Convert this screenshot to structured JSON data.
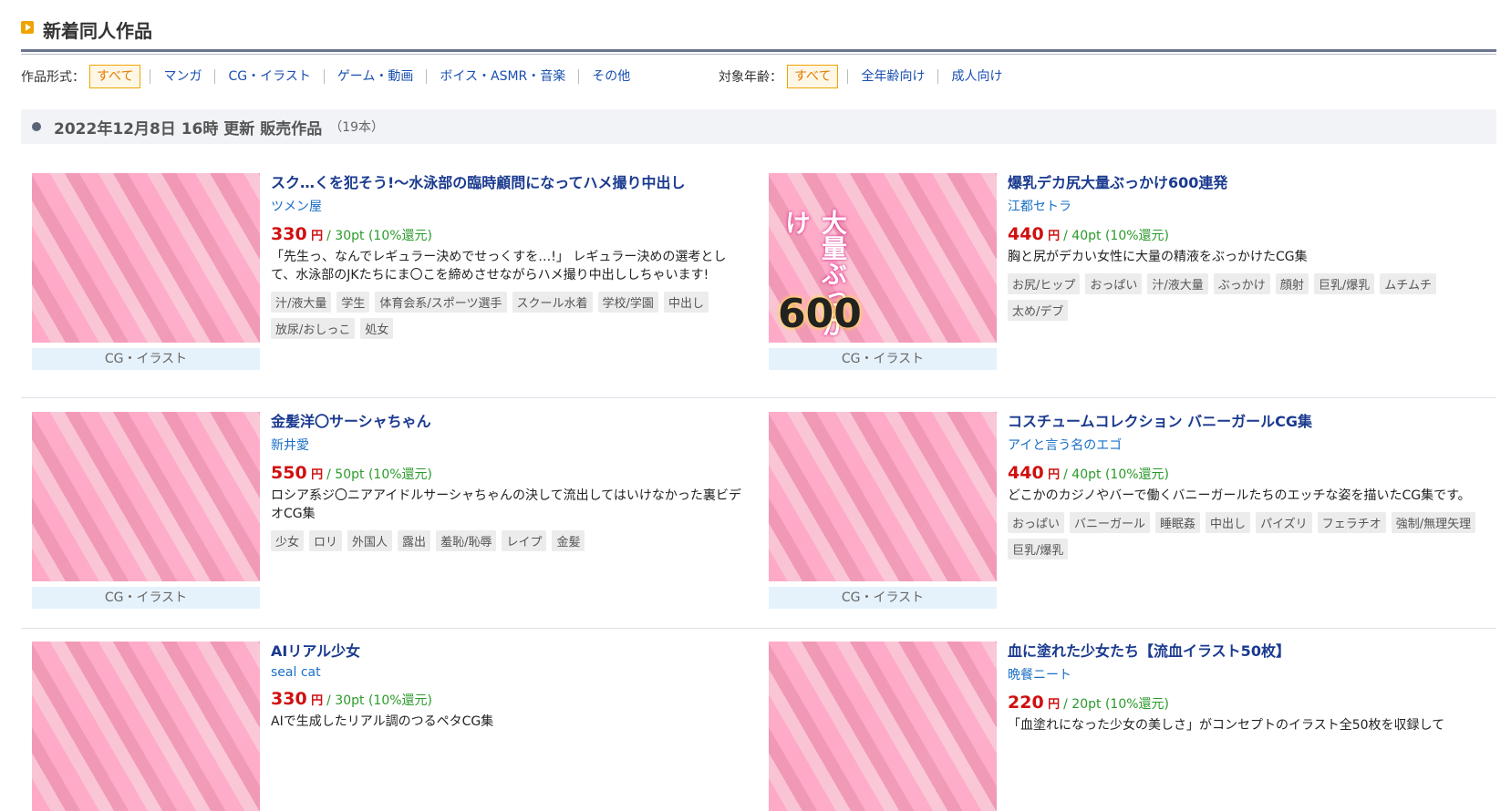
{
  "header": {
    "title": "新着同人作品"
  },
  "filters": {
    "format_label": "作品形式：",
    "format_items": [
      "すべて",
      "マンガ",
      "CG・イラスト",
      "ゲーム・動画",
      "ボイス・ASMR・音楽",
      "その他"
    ],
    "age_label": "対象年齢：",
    "age_items": [
      "すべて",
      "全年齢向け",
      "成人向け"
    ]
  },
  "section": {
    "title": "2022年12月8日 16時 更新 販売作品",
    "count": "（19本）"
  },
  "products": [
    {
      "title": "スク…くを犯そう!〜水泳部の臨時顧問になってハメ撮り中出し",
      "maker": "ツメン屋",
      "price": "330",
      "yen": "円",
      "points": "/ 30pt (10%還元)",
      "desc": "「先生っ、なんでレギュラー決めでせっくすを…!」 レギュラー決めの選考として、水泳部のJKたちにま〇こを締めさせながらハメ撮り中出ししちゃいます!",
      "category": "CG・イラスト",
      "tags": [
        "汁/液大量",
        "学生",
        "体育会系/スポーツ選手",
        "スクール水着",
        "学校/学園",
        "中出し",
        "放尿/おしっこ",
        "処女"
      ]
    },
    {
      "title": "爆乳デカ尻大量ぶっかけ600連発",
      "maker": "江都セトラ",
      "price": "440",
      "yen": "円",
      "points": "/ 40pt (10%還元)",
      "desc": "胸と尻がデカい女性に大量の精液をぶっかけたCG集",
      "category": "CG・イラスト",
      "thumb_text": "600",
      "thumb_vtext": "大量ぶっかけ",
      "tags": [
        "お尻/ヒップ",
        "おっぱい",
        "汁/液大量",
        "ぶっかけ",
        "顔射",
        "巨乳/爆乳",
        "ムチムチ",
        "太め/デブ"
      ]
    },
    {
      "title": "金髪洋〇サーシャちゃん",
      "maker": "新井愛",
      "price": "550",
      "yen": "円",
      "points": "/ 50pt (10%還元)",
      "desc": "ロシア系ジ〇ニアアイドルサーシャちゃんの決して流出してはいけなかった裏ビデオCG集",
      "category": "CG・イラスト",
      "tags": [
        "少女",
        "ロリ",
        "外国人",
        "露出",
        "羞恥/恥辱",
        "レイプ",
        "金髪"
      ]
    },
    {
      "title": "コスチュームコレクション バニーガールCG集",
      "maker": "アイと言う名のエゴ",
      "price": "440",
      "yen": "円",
      "points": "/ 40pt (10%還元)",
      "desc": "どこかのカジノやバーで働くバニーガールたちのエッチな姿を描いたCG集です。",
      "category": "CG・イラスト",
      "tags": [
        "おっぱい",
        "バニーガール",
        "睡眠姦",
        "中出し",
        "パイズリ",
        "フェラチオ",
        "強制/無理矢理",
        "巨乳/爆乳"
      ]
    },
    {
      "title": "AIリアル少女",
      "maker": "seal cat",
      "price": "330",
      "yen": "円",
      "points": "/ 30pt (10%還元)",
      "desc": "AIで生成したリアル調のつるペタCG集",
      "category": "",
      "tags": []
    },
    {
      "title": "血に塗れた少女たち【流血イラスト50枚】",
      "maker": "晩餐ニート",
      "price": "220",
      "yen": "円",
      "points": "/ 20pt (10%還元)",
      "desc": "「血塗れになった少女の美しさ」がコンセプトのイラスト全50枚を収録して",
      "category": "",
      "tags": []
    }
  ]
}
